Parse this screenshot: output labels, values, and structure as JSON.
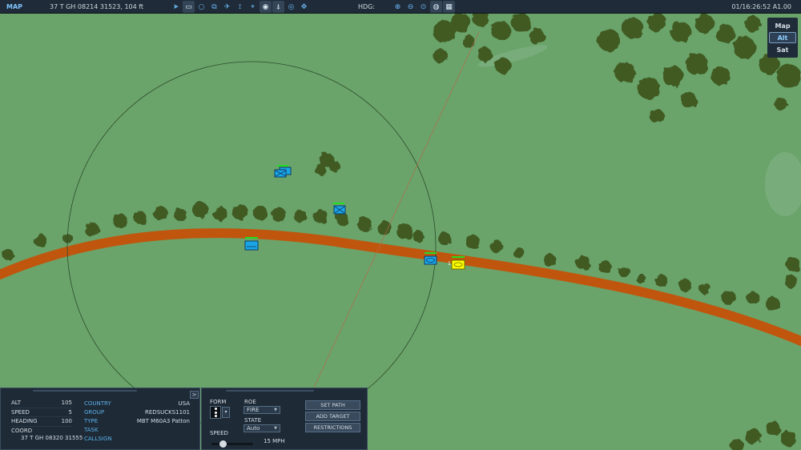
{
  "topbar": {
    "title": "MAP",
    "coordinates": "37 T GH 08214 31523, 104 ft",
    "heading_label": "HDG:",
    "timestamp": "01/16:26:52 A1.00",
    "tools": [
      {
        "icon": "navigate-icon",
        "glyph": "➤",
        "active": false
      },
      {
        "icon": "ruler-icon",
        "glyph": "▭",
        "active": true
      },
      {
        "icon": "circle-icon",
        "glyph": "○",
        "active": false
      },
      {
        "icon": "vehicles-icon",
        "glyph": "⧉",
        "active": false
      },
      {
        "icon": "aircraft-icon",
        "glyph": "✈",
        "active": false
      },
      {
        "icon": "route-icon",
        "glyph": "⟟",
        "active": false
      },
      {
        "icon": "target-icon",
        "glyph": "⌖",
        "active": false
      },
      {
        "icon": "signal-icon",
        "glyph": "◉",
        "active": true
      },
      {
        "icon": "tower-icon",
        "glyph": "⍋",
        "active": true
      },
      {
        "icon": "radar-icon",
        "glyph": "◎",
        "active": false
      },
      {
        "icon": "move-icon",
        "glyph": "✥",
        "active": false
      }
    ],
    "zoom_tools": [
      {
        "icon": "zoom-in-icon",
        "glyph": "⊕",
        "active": false
      },
      {
        "icon": "zoom-out-icon",
        "glyph": "⊖",
        "active": false
      },
      {
        "icon": "zoom-fit-icon",
        "glyph": "⊙",
        "active": false
      },
      {
        "icon": "globe-icon",
        "glyph": "◍",
        "active": true
      },
      {
        "icon": "grid-icon",
        "glyph": "▦",
        "active": true
      }
    ]
  },
  "layers": [
    {
      "label": "Map",
      "active": false
    },
    {
      "label": "Alt",
      "active": true
    },
    {
      "label": "Sat",
      "active": false
    }
  ],
  "unit_stats": {
    "alt_label": "ALT",
    "alt_value": "105",
    "speed_label": "SPEED",
    "speed_value": "5",
    "heading_label": "HEADING",
    "heading_value": "100",
    "coord_label": "COORD",
    "coord_value": "37 T GH 08320 31555"
  },
  "unit_info": {
    "country_label": "COUNTRY",
    "country_value": "USA",
    "group_label": "GROUP",
    "group_value": "REDSUCKS1101",
    "type_label": "TYPE",
    "type_value": "MBT M60A3 Patton",
    "task_label": "TASK",
    "task_value": "",
    "callsign_label": "CALLSIGN",
    "callsign_value": ""
  },
  "expand_label": ">",
  "orders": {
    "form_label": "FORM",
    "roe_label": "ROE",
    "roe_value": "FIRE",
    "state_label": "STATE",
    "state_value": "Auto",
    "speed_label": "SPEED",
    "speed_value": "15 MPH",
    "speed_fraction": 0.28,
    "set_path_label": "SET PATH",
    "add_target_label": "ADD TARGET",
    "restrictions_label": "RESTRICTIONS"
  },
  "colors": {
    "terrain": "#6aa46a",
    "forest": "#3f5a23",
    "road": "#c0560e",
    "friendly_unit": "#1aa6e6",
    "selected_unit": "#ffff00",
    "health_bar": "#22dd22"
  }
}
